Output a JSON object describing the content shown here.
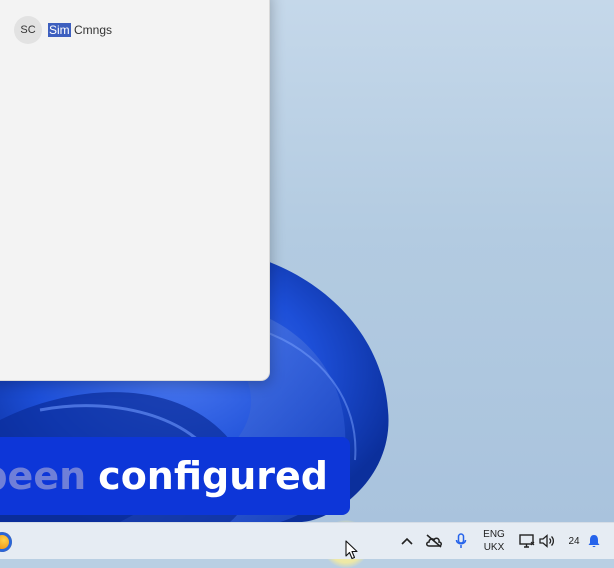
{
  "start_panel": {
    "user": {
      "initials": "SC",
      "name_highlight": "Sim",
      "name_rest": " Cmngs"
    }
  },
  "caption": {
    "dim_text": "been",
    "bright_text": "configured"
  },
  "taskbar": {
    "language_line1": "ENG",
    "language_line2": "UKX",
    "clock_partial": "24"
  },
  "colors": {
    "caption_bg": "#0d36d8",
    "accent": "#2563eb",
    "highlight": "#3d5fbf"
  },
  "icons": [
    "browser-icon",
    "chevron-up-icon",
    "onedrive-icon",
    "microphone-icon",
    "network-icon",
    "volume-icon",
    "notification-bell-icon",
    "mouse-cursor-icon"
  ]
}
